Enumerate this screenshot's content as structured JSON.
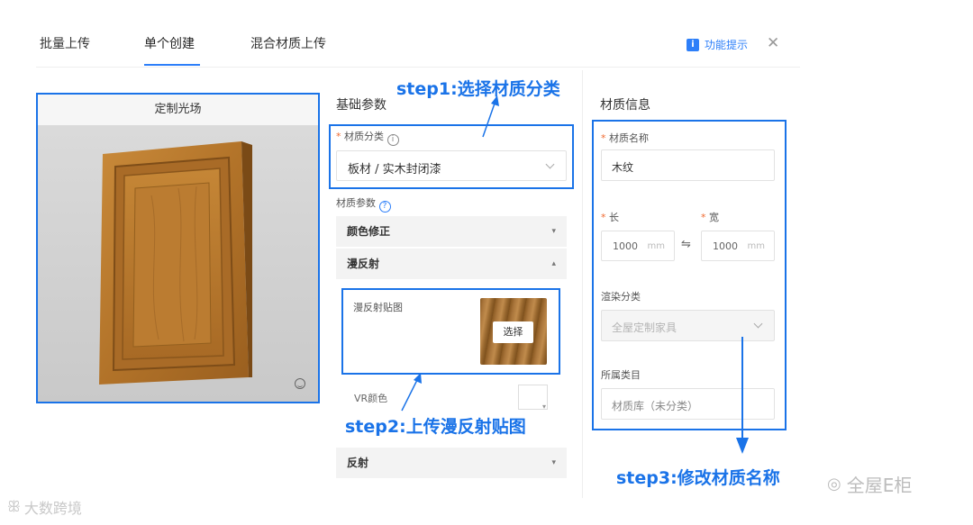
{
  "tabs": [
    {
      "label": "批量上传"
    },
    {
      "label": "单个创建"
    },
    {
      "label": "混合材质上传"
    }
  ],
  "active_tab": "单个创建",
  "help": {
    "label": "功能提示"
  },
  "preview": {
    "title": "定制光场"
  },
  "basic": {
    "title": "基础参数",
    "category_label": "材质分类",
    "category_value": "板材 / 实木封闭漆",
    "params_label": "材质参数",
    "color_correction": "颜色修正",
    "diffuse": "漫反射",
    "diffuse_map_label": "漫反射贴图",
    "choose_button": "选择",
    "vr_color_label": "VR颜色",
    "reflection": "反射"
  },
  "material": {
    "title": "材质信息",
    "name_label": "材质名称",
    "name_value": "木纹",
    "length_label": "长",
    "length_value": "1000",
    "width_label": "宽",
    "width_value": "1000",
    "unit": "mm",
    "render_label": "渲染分类",
    "render_value": "全屋定制家具",
    "category_label": "所属类目",
    "category_value": "材质库（未分类）"
  },
  "steps": {
    "step1": "step1:选择材质分类",
    "step2": "step2:上传漫反射贴图",
    "step3": "step3:修改材质名称"
  },
  "watermarks": {
    "left": "大数跨境",
    "right": "全屋E柜"
  },
  "colors": {
    "accent": "#1a73e8",
    "required": "#f06a30"
  }
}
